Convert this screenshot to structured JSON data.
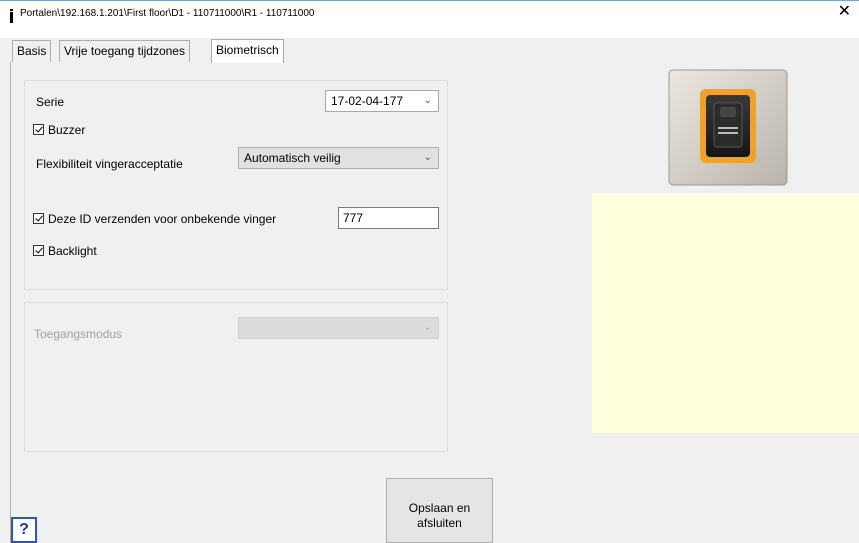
{
  "window": {
    "title": "Portalen\\192.168.1.201\\First floor\\D1 - 110711000\\R1 - 110711000",
    "close_glyph": "✕"
  },
  "tabs": [
    {
      "label": "Basis",
      "active": false
    },
    {
      "label": "Vrije toegang tijdzones",
      "active": false
    },
    {
      "label": "Biometrisch",
      "active": true
    }
  ],
  "settings": {
    "serie_label": "Serie",
    "serie_value": "17-02-04-177",
    "buzzer_label": "Buzzer",
    "buzzer_checked": true,
    "flex_label": "Flexibiliteit vingeracceptatie",
    "flex_value": "Automatisch veilig",
    "send_id_label": "Deze ID verzenden voor onbekende vinger",
    "send_id_checked": true,
    "send_id_value": "777",
    "backlight_label": "Backlight",
    "backlight_checked": true
  },
  "access": {
    "mode_label": "Toegangsmodus",
    "mode_value": ""
  },
  "buttons": {
    "save_line1": "Opslaan en",
    "save_line2": "afsluiten",
    "help": "?"
  },
  "icons": {
    "dropdown": "chevron-down-icon",
    "close": "close-icon",
    "reader": "fingerprint-reader-image"
  },
  "colors": {
    "info_panel": "#ffffdd",
    "reader_accent": "#f0a12a",
    "help_border": "#2a58b8"
  }
}
